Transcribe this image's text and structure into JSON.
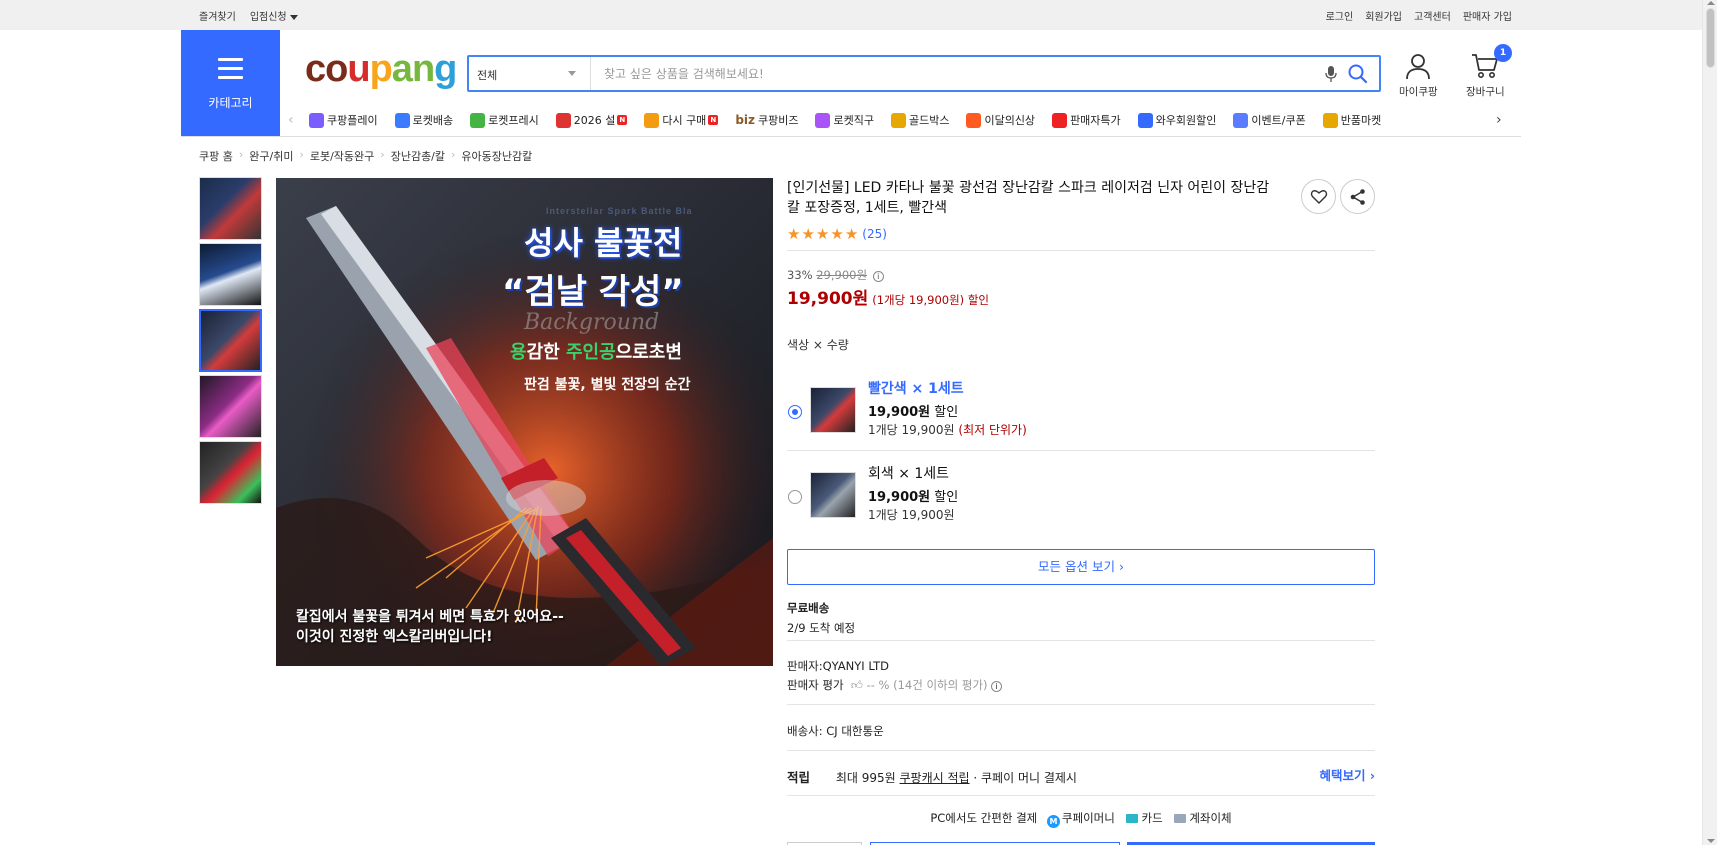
{
  "topbar": {
    "left": [
      "즐겨찾기",
      "입점신청"
    ],
    "right": [
      "로그인",
      "회원가입",
      "고객센터",
      "판매자 가입"
    ]
  },
  "header": {
    "category_label": "카테고리",
    "logo": [
      "c",
      "o",
      "u",
      "p",
      "a",
      "n",
      "g"
    ],
    "search": {
      "category": "전체",
      "placeholder": "찾고 싶은 상품을 검색해보세요!"
    },
    "my_coupang": "마이쿠팡",
    "cart": "장바구니",
    "cart_count": "1"
  },
  "nav": [
    {
      "label": "쿠팡플레이",
      "color": "#7b5cff"
    },
    {
      "label": "로켓배송",
      "color": "#3a7bff"
    },
    {
      "label": "로켓프레시",
      "color": "#44b544"
    },
    {
      "label": "2026 설",
      "color": "#d33",
      "new": true
    },
    {
      "label": "다시 구매",
      "color": "#f39c12",
      "new": true
    },
    {
      "label": "쿠팡비즈",
      "color": "#8a5a2b",
      "prefix": "biz"
    },
    {
      "label": "로켓직구",
      "color": "#a855f7"
    },
    {
      "label": "골드박스",
      "color": "#e6a800"
    },
    {
      "label": "이달의신상",
      "color": "#ff5a1f"
    },
    {
      "label": "판매자특가",
      "color": "#e22"
    },
    {
      "label": "와우회원할인",
      "color": "#346aff"
    },
    {
      "label": "이벤트/쿠폰",
      "color": "#5b7cff"
    },
    {
      "label": "반품마켓",
      "color": "#e6a800"
    }
  ],
  "breadcrumb": [
    "쿠팡 홈",
    "완구/취미",
    "로봇/작동완구",
    "장난감총/칼",
    "유아동장난감칼"
  ],
  "product": {
    "title": "[인기선물] LED 카타나 불꽃 광선검 장난감칼 스파크 레이저검 닌자 어린이 장난감 칼 포장증정, 1세트, 빨간색",
    "review_count": "(25)",
    "rating": 5,
    "discount": "33%",
    "original_price": "29,900원",
    "price": "19,900원",
    "unit_price": "(1개당 19,900원) 할인",
    "option_label": "색상 × 수량",
    "options": [
      {
        "name": "빨간색 × 1세트",
        "price": "19,900원",
        "sale": "할인",
        "per": "1개당 19,900원",
        "lowest": "(최저 단위가)",
        "selected": true
      },
      {
        "name": "회색 × 1세트",
        "price": "19,900원",
        "sale": "할인",
        "per": "1개당 19,900원",
        "lowest": "",
        "selected": false
      }
    ],
    "all_options": "모든 옵션 보기 ›"
  },
  "image_text": {
    "banner": "Interstellar Spark Battle Bla",
    "headline1": "성사 불꽃전",
    "headline2": "“검날 각성”",
    "watermark": "Background",
    "sub1_a": "용",
    "sub1_b": "감한 ",
    "sub1_c": "주인공",
    "sub1_d": "으로초변",
    "sub2": "판검 불꽃, 별빛 전장의 순간",
    "bottom1": "칼집에서 불꽃을 튀겨서 베면 특효가 있어요--",
    "bottom2": "이것이 진정한 엑스칼리버입니다!"
  },
  "shipping": {
    "title": "무료배송",
    "arrival": "2/9 도착 예정"
  },
  "seller": {
    "name": "판매자:QYANYI LTD",
    "rating_label": "판매자 평가",
    "rating_value": "-- %",
    "rating_note": "(14건 이하의 평가)"
  },
  "carrier": "배송사:  CJ 대한통운",
  "reward": {
    "label": "적립",
    "max": "최대 995원",
    "cash": "쿠팡캐시 적립",
    "rest": " · 쿠페이 머니 결제시",
    "benefit": "혜택보기 ›"
  },
  "pay": {
    "title": "PC에서도 간편한 결제",
    "m1": "쿠페이머니",
    "m2": "카드",
    "m3": "계좌이체"
  },
  "colors": {
    "accent": "#346aff",
    "price": "#ae0000",
    "star": "#f6932a"
  }
}
